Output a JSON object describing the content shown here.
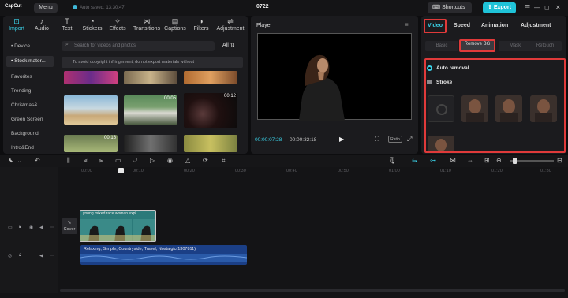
{
  "app": {
    "logo": "CapCut",
    "menu_label": "Menu",
    "autosave": "Auto saved: 13:30:47",
    "project_title": "0722",
    "shortcuts_label": "Shortcuts",
    "export_label": "Export"
  },
  "media_tabs": [
    {
      "label": "Import",
      "icon": "import-icon"
    },
    {
      "label": "Audio",
      "icon": "audio-icon"
    },
    {
      "label": "Text",
      "icon": "text-icon"
    },
    {
      "label": "Stickers",
      "icon": "stickers-icon"
    },
    {
      "label": "Effects",
      "icon": "effects-icon"
    },
    {
      "label": "Transitions",
      "icon": "transitions-icon"
    },
    {
      "label": "Captions",
      "icon": "captions-icon"
    },
    {
      "label": "Filters",
      "icon": "filters-icon"
    },
    {
      "label": "Adjustment",
      "icon": "adjustment-icon"
    }
  ],
  "sidebar": {
    "items": [
      "• Device",
      "• Stock mater...",
      "Favorites",
      "Trending",
      "Christmas&...",
      "Green Screen",
      "Background",
      "Intro&End"
    ]
  },
  "library": {
    "search_placeholder": "Search for videos and photos",
    "filter_label": "All",
    "notice": "To avoid copyright infringement, do not export materials without",
    "durations": [
      "00:05",
      "00:12",
      "00:16"
    ]
  },
  "player": {
    "title": "Player",
    "time_current": "00:00:07:28",
    "time_total": "00:00:32:18",
    "ratio_label": "Ratio"
  },
  "inspector": {
    "tabs": [
      "Video",
      "Speed",
      "Animation",
      "Adjustment"
    ],
    "subtabs": [
      "Basic",
      "Remove BG",
      "Mask",
      "Retouch"
    ],
    "auto_removal": "Auto removal",
    "stroke": "Stroke"
  },
  "timeline": {
    "ruler": [
      "00:00",
      "00:10",
      "00:20",
      "00:30",
      "00:40",
      "00:50",
      "01:00",
      "01:10",
      "01:20",
      "01:30"
    ],
    "cover_label": "Cover",
    "main_clip_label": "young  mixed  race  woman  expl",
    "audio_clip_label": "Relaxing, Simple, Countryside, Travel, Nostalgic(1307811)"
  },
  "colors": {
    "accent": "#3ad0e6",
    "export": "#1fc3d8",
    "highlight": "#e03a3a",
    "audio_clip": "#1b3f86",
    "video_clip": "#2b7a7a"
  }
}
